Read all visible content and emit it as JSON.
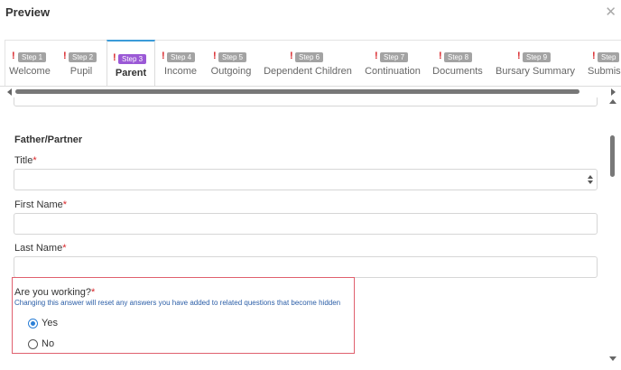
{
  "dialog": {
    "title": "Preview",
    "close_icon": "close-icon",
    "close_glyph": "✕"
  },
  "tabs": [
    {
      "step": "Step 1",
      "label": "Welcome",
      "warning": "!",
      "active": false
    },
    {
      "step": "Step 2",
      "label": "Pupil",
      "warning": "!",
      "active": false
    },
    {
      "step": "Step 3",
      "label": "Parent",
      "warning": "!",
      "active": true
    },
    {
      "step": "Step 4",
      "label": "Income",
      "warning": "!",
      "active": false
    },
    {
      "step": "Step 5",
      "label": "Outgoing",
      "warning": "!",
      "active": false
    },
    {
      "step": "Step 6",
      "label": "Dependent Children",
      "warning": "!",
      "active": false
    },
    {
      "step": "Step 7",
      "label": "Continuation",
      "warning": "!",
      "active": false
    },
    {
      "step": "Step 8",
      "label": "Documents",
      "warning": "!",
      "active": false
    },
    {
      "step": "Step 9",
      "label": "Bursary Summary",
      "warning": "!",
      "active": false
    },
    {
      "step": "Step",
      "label": "Submis",
      "warning": "!",
      "active": false
    }
  ],
  "colors": {
    "active_step_badge": "#9b59d6",
    "inactive_step_badge": "#a3a3a3",
    "warning": "#d9262a",
    "required": "#d9262a",
    "help_text": "#2b5ea7",
    "active_tab_border": "#3b9bd9",
    "highlight_box": "#e0606e",
    "radio_selected": "#2b7fd6"
  },
  "form": {
    "section_title": "Father/Partner",
    "required_marker": "*",
    "title_field": {
      "label": "Title",
      "value": ""
    },
    "first_name_field": {
      "label": "First Name",
      "value": ""
    },
    "last_name_field": {
      "label": "Last Name",
      "value": ""
    },
    "working_question": {
      "label": "Are you working?",
      "help_text": "Changing this answer will reset any answers you have added to related questions that become hidden",
      "options": [
        {
          "label": "Yes",
          "checked": true
        },
        {
          "label": "No",
          "checked": false
        }
      ]
    }
  }
}
